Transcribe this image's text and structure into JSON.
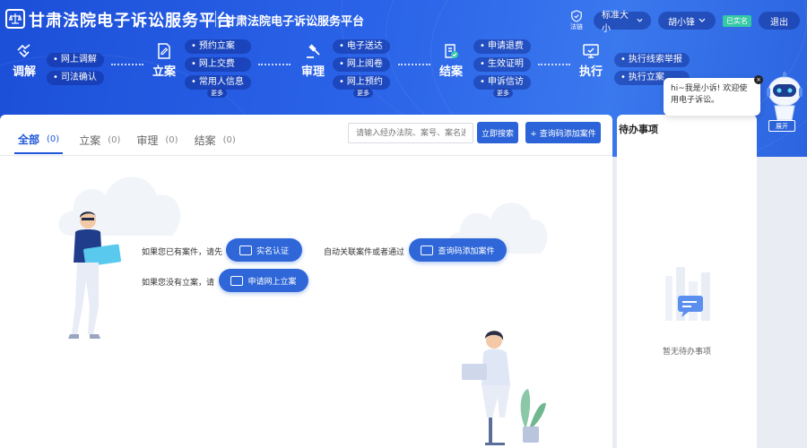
{
  "header": {
    "title": "甘肃法院电子诉讼服务平台",
    "subtitle": "甘肃法院电子诉讼服务平台",
    "shield_label": "法链",
    "font_size_label": "标准大小",
    "user_name": "胡小锋",
    "verified_badge": "已实名",
    "logout_label": "退出"
  },
  "process": {
    "stages": [
      {
        "label": "调解",
        "icon": "handshake-icon",
        "chips": [
          "网上调解",
          "司法确认"
        ],
        "more": ""
      },
      {
        "label": "立案",
        "icon": "file-edit-icon",
        "chips": [
          "预约立案",
          "网上交费",
          "常用人信息"
        ],
        "more": "更多"
      },
      {
        "label": "审理",
        "icon": "gavel-icon",
        "chips": [
          "电子送达",
          "网上阅卷",
          "网上预约"
        ],
        "more": "更多"
      },
      {
        "label": "结案",
        "icon": "case-closed-icon",
        "chips": [
          "申请退费",
          "生效证明",
          "申诉信访"
        ],
        "more": "更多"
      },
      {
        "label": "执行",
        "icon": "monitor-icon",
        "chips": [
          "执行线索举报",
          "执行立案"
        ],
        "more": ""
      }
    ]
  },
  "main": {
    "tabs": [
      {
        "label": "全部",
        "count": "(0)"
      },
      {
        "label": "立案",
        "count": "(0)"
      },
      {
        "label": "审理",
        "count": "(0)"
      },
      {
        "label": "结案",
        "count": "(0)"
      }
    ],
    "search_placeholder": "请输入经办法院、案号、案名进行",
    "search_button": "立即搜索",
    "add_case_button": "+ 查询码添加案件",
    "line1_prefix": "如果您已有案件，请先",
    "realname_button": "实名认证",
    "line1_middle": "自动关联案件或者通过",
    "querycode_button": "查询码添加案件",
    "line2_prefix": "如果您没有立案，请",
    "apply_button": "申请网上立案"
  },
  "side": {
    "title": "待办事项",
    "empty_text": "暂无待办事项"
  },
  "robot": {
    "bubble_text": "hi~我是小诉! 欢迎使用电子诉讼。",
    "expand_label": "展开"
  },
  "colors": {
    "brand_blue": "#1d56d7",
    "button_blue": "#2c63d8",
    "verified_green": "#35c9a5"
  }
}
